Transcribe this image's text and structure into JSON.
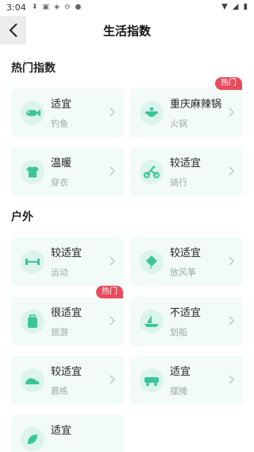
{
  "status_bar": {
    "time": "3:04"
  },
  "app_bar": {
    "title": "生活指数"
  },
  "sections": [
    {
      "title": "热门指数"
    },
    {
      "title": "户外"
    }
  ],
  "cards": [
    {
      "level": "适宜",
      "name": "钓鱼",
      "icon": "fishing-icon"
    },
    {
      "level": "重庆麻辣锅",
      "name": "火锅",
      "icon": "hotpot-icon",
      "badge": "热门"
    },
    {
      "level": "温暖",
      "name": "穿衣",
      "icon": "clothing-icon"
    },
    {
      "level": "较适宜",
      "name": "骑行",
      "icon": "cycling-icon"
    },
    {
      "level": "较适宜",
      "name": "运动",
      "icon": "exercise-icon"
    },
    {
      "level": "较适宜",
      "name": "放风筝",
      "icon": "kite-icon"
    },
    {
      "level": "很适宜",
      "name": "旅游",
      "icon": "travel-icon",
      "badge": "热门"
    },
    {
      "level": "不适宜",
      "name": "划船",
      "icon": "boating-icon"
    },
    {
      "level": "较适宜",
      "name": "晨练",
      "icon": "morning-exercise-icon"
    },
    {
      "level": "适宜",
      "name": "摆摊",
      "icon": "street-stall-icon"
    },
    {
      "level": "适宜",
      "name": "",
      "icon": "leaf-icon"
    }
  ],
  "colors": {
    "accent": "#3cc49a",
    "card_bg": "#f3fbf8",
    "badge": "#e84c5b"
  }
}
